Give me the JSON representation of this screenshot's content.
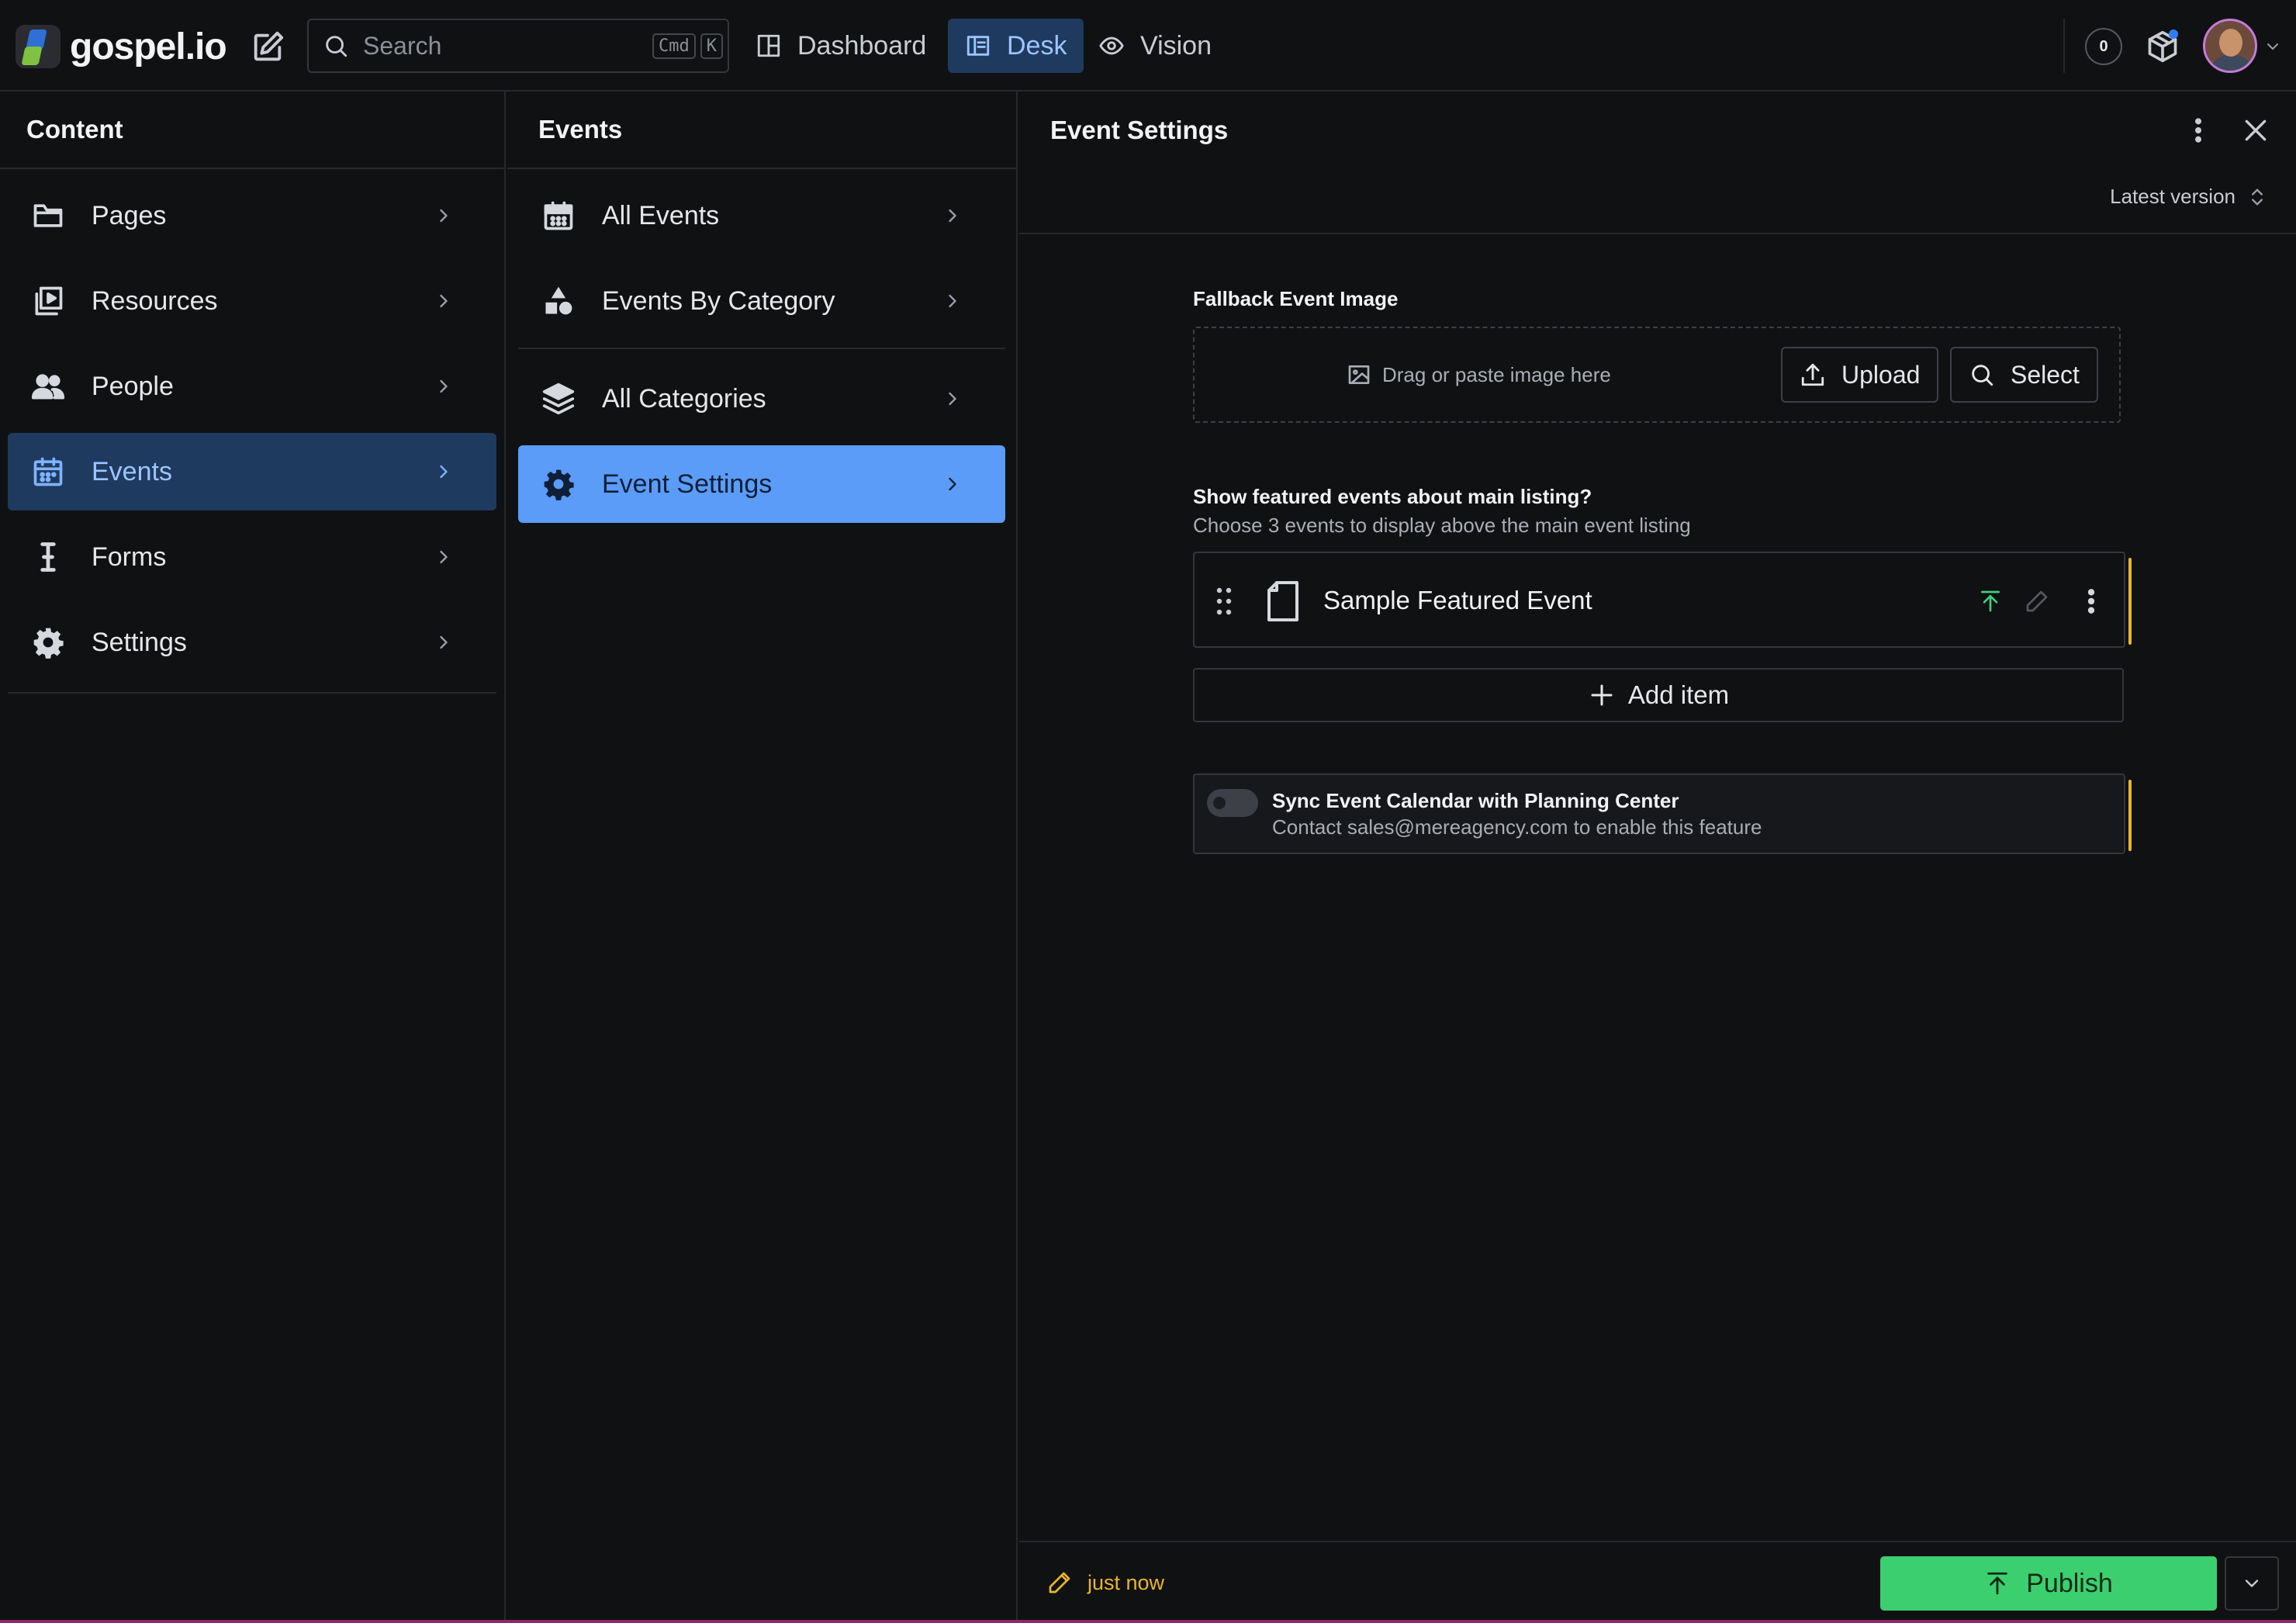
{
  "app": {
    "logo_text": "gospel.io"
  },
  "topbar": {
    "search_placeholder": "Search",
    "shortcut_cmd": "Cmd",
    "shortcut_key": "K",
    "tabs": [
      {
        "label": "Dashboard",
        "icon": "dashboard-icon",
        "active": false
      },
      {
        "label": "Desk",
        "icon": "desk-icon",
        "active": true
      },
      {
        "label": "Vision",
        "icon": "eye-icon",
        "active": false
      }
    ],
    "notification_count": "0"
  },
  "content_pane": {
    "title": "Content",
    "items": [
      {
        "label": "Pages",
        "icon": "folder-icon"
      },
      {
        "label": "Resources",
        "icon": "media-library-icon"
      },
      {
        "label": "People",
        "icon": "people-icon"
      },
      {
        "label": "Events",
        "icon": "calendar-icon",
        "selected": true
      },
      {
        "label": "Forms",
        "icon": "text-cursor-icon"
      },
      {
        "label": "Settings",
        "icon": "gear-icon"
      }
    ]
  },
  "events_pane": {
    "title": "Events",
    "items": [
      {
        "label": "All Events",
        "icon": "calendar-icon"
      },
      {
        "label": "Events By Category",
        "icon": "shapes-icon"
      },
      {
        "label": "All Categories",
        "icon": "layers-icon"
      },
      {
        "label": "Event Settings",
        "icon": "gear-icon",
        "selected": true
      }
    ]
  },
  "document": {
    "title": "Event Settings",
    "version_label": "Latest version",
    "fallback_image": {
      "label": "Fallback Event Image",
      "drop_text": "Drag or paste image here",
      "upload_label": "Upload",
      "select_label": "Select"
    },
    "featured": {
      "label": "Show featured events about main listing?",
      "description": "Choose 3 events to display above the main event listing",
      "items": [
        {
          "title": "Sample Featured Event"
        }
      ],
      "add_label": "Add item"
    },
    "sync": {
      "title": "Sync Event Calendar with Planning Center",
      "description": "Contact sales@mereagency.com to enable this feature",
      "enabled": false
    }
  },
  "footer": {
    "saved_text": "just now",
    "publish_label": "Publish"
  },
  "colors": {
    "background": "#101113",
    "accent_blue": "#5a9cf8",
    "selected_dark": "#1f3a5f",
    "publish_green": "#3ccf6f",
    "changed_yellow": "#e9b62a"
  }
}
